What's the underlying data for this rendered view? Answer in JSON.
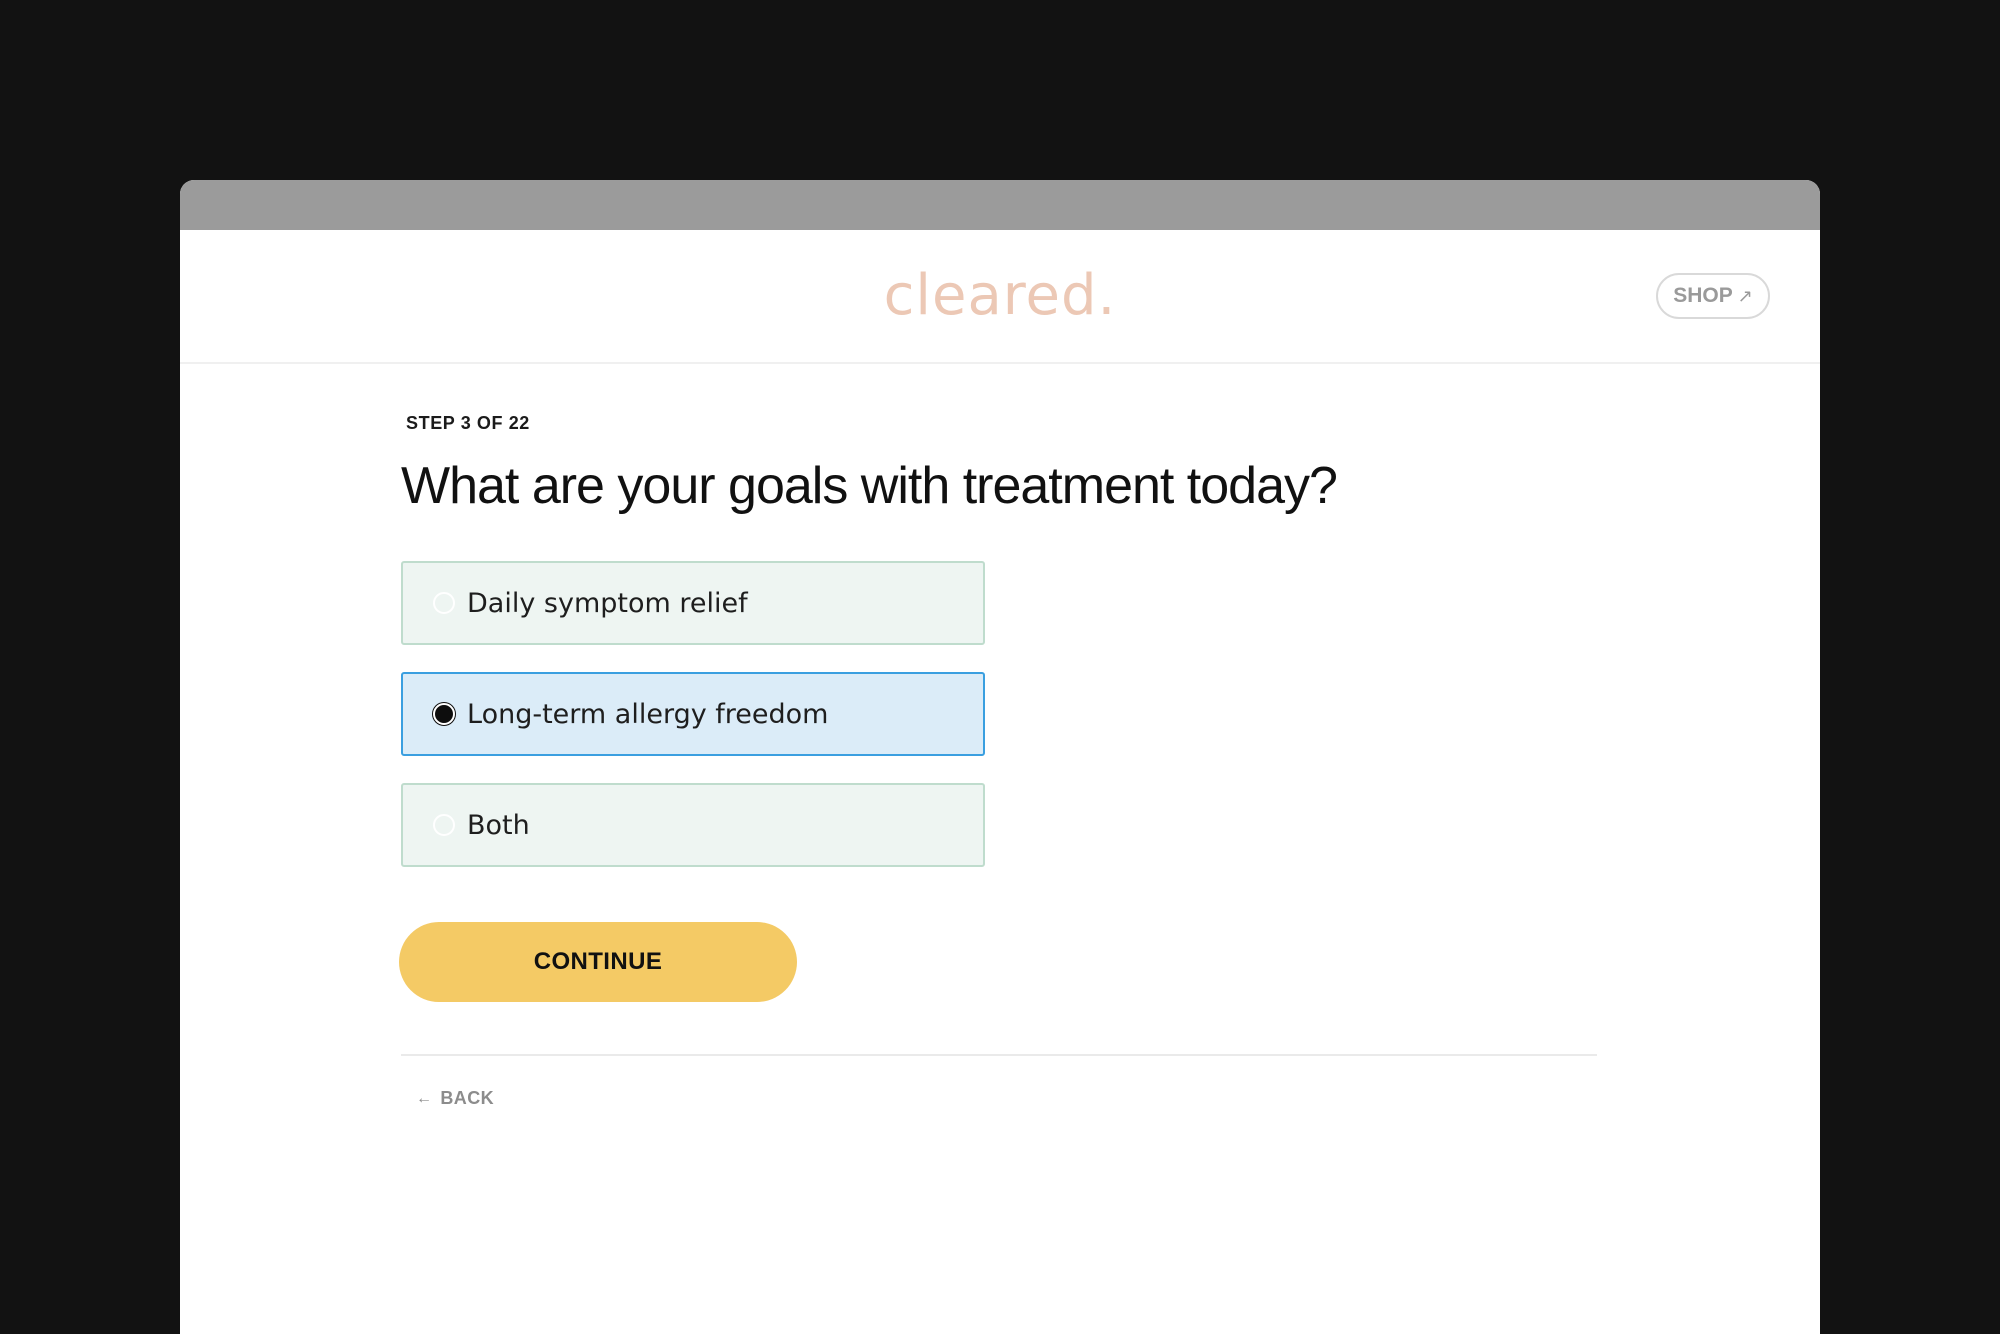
{
  "header": {
    "logo_text": "cleared.",
    "shop_label": "SHOP",
    "shop_icon": "external-arrow-icon"
  },
  "quiz": {
    "step_label": "STEP 3 OF 22",
    "question": "What are your goals with treatment today?",
    "options": [
      {
        "label": "Daily symptom relief",
        "selected": false
      },
      {
        "label": "Long-term allergy freedom",
        "selected": true
      },
      {
        "label": "Both",
        "selected": false
      }
    ],
    "continue_label": "CONTINUE",
    "back_label": "BACK",
    "back_icon": "arrow-left-icon"
  },
  "colors": {
    "background": "#121212",
    "titlebar": "#9b9b9b",
    "logo": "#ecc8b5",
    "option_bg": "#eef5f2",
    "option_border": "#bfdccd",
    "option_selected_bg": "#dbecf8",
    "option_selected_border": "#3a9fe0",
    "continue_button": "#f4ca65"
  }
}
